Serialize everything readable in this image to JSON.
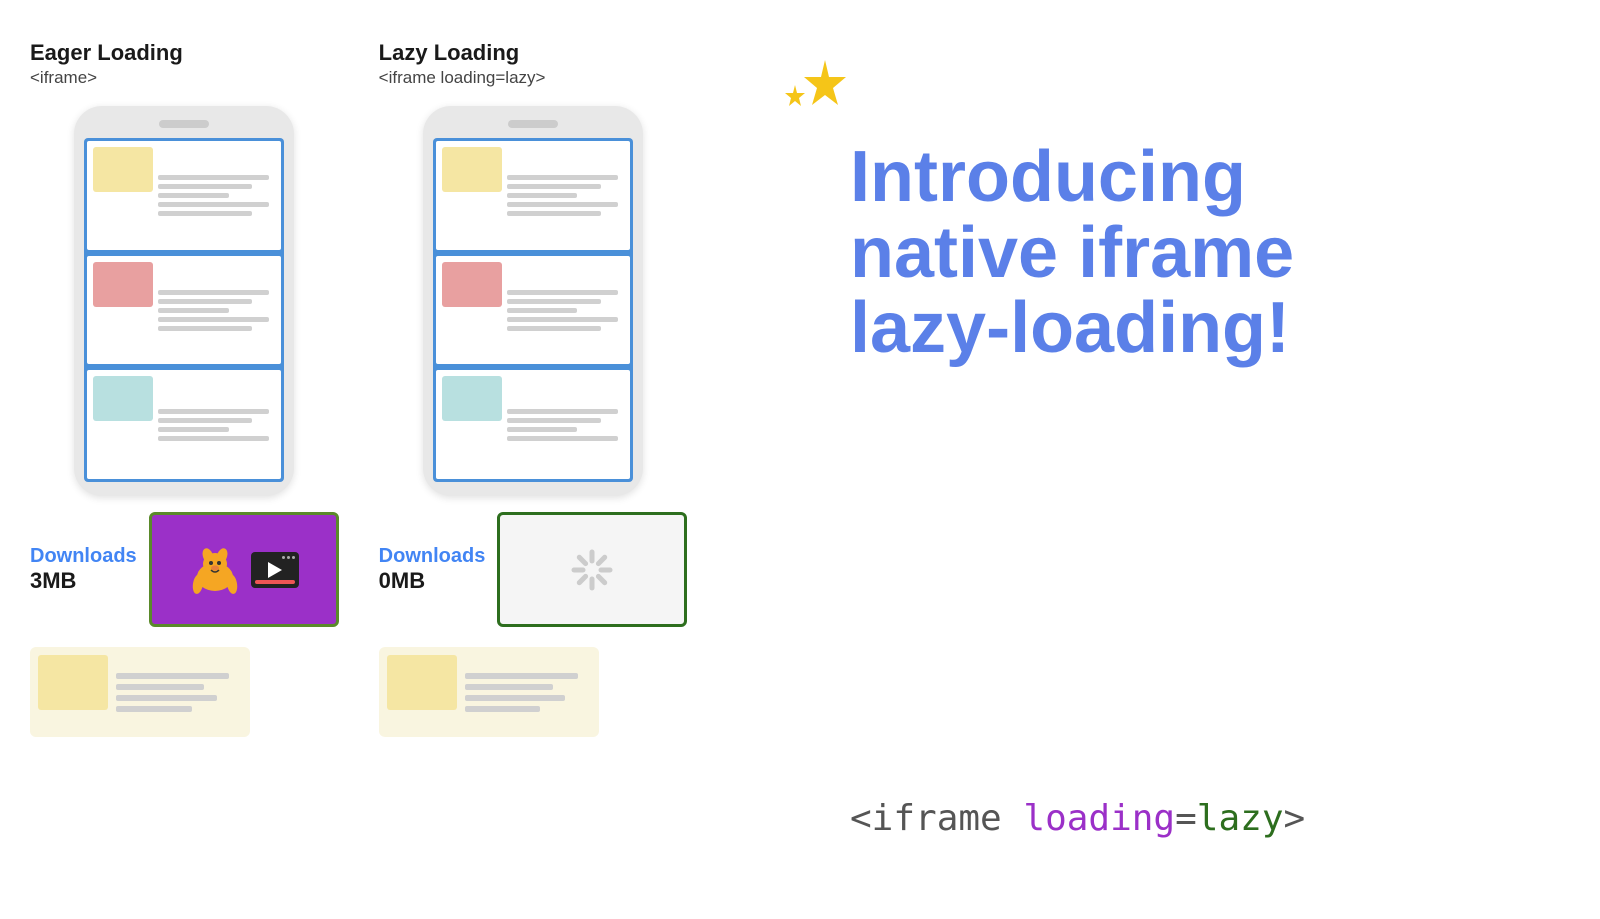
{
  "eager": {
    "title": "Eager Loading",
    "subtitle": "<iframe>",
    "downloads_label": "Downloads",
    "downloads_size": "3MB"
  },
  "lazy": {
    "title": "Lazy Loading",
    "subtitle": "<iframe loading=lazy>",
    "downloads_label": "Downloads",
    "downloads_size": "0MB"
  },
  "intro": {
    "line1": "Introducing",
    "line2": "native iframe",
    "line3": "lazy-loading!"
  },
  "code": {
    "full": "<iframe loading=lazy>",
    "iframe_part": "<iframe",
    "space": " ",
    "loading_word": "loading",
    "equals": "=",
    "lazy_word": "lazy",
    "close": ">"
  }
}
